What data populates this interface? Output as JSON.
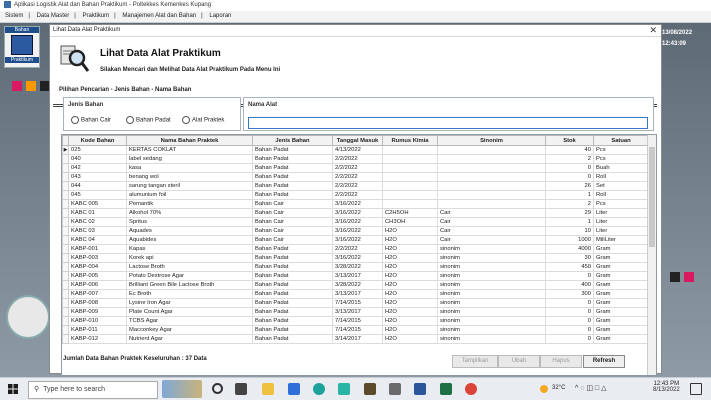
{
  "app": {
    "title": "Aplikasi Logistik Alat dan Bahan Praktikum - Poltekkes Kemenkes Kupang",
    "menu": [
      "Sistem",
      "Data Master",
      "Praktikum",
      "Manajemen Alat dan Bahan",
      "Laporan"
    ]
  },
  "launcher": {
    "header": "Bahan",
    "footer": "Praktikum"
  },
  "desk_date": "13/08/2022",
  "desk_time": "12:43:09",
  "window": {
    "title": "Lihat Data Alat Praktikum",
    "close_glyph": "✕",
    "page_title": "Lihat Data Alat Praktikum",
    "page_subtitle": "Silakan Mencari dan Melihat Data Alat Praktikum Pada Menu Ini"
  },
  "filter": {
    "section_label": "Pilihan Pencarian - Jenis Bahan - Nama Bahan",
    "jenis_label": "Jenis Bahan",
    "options": [
      "Bahan Cair",
      "Bahan Padat",
      "Alat Praktek"
    ],
    "nama_label": "Nama Alat",
    "nama_value": ""
  },
  "table": {
    "columns": [
      "Kode Bahan",
      "Nama Bahan Praktek",
      "Jenis Bahan",
      "Tanggal Masuk",
      "Rumus Kimia",
      "Sinonim",
      "Stok",
      "Satuan"
    ],
    "rows": [
      [
        "025",
        "KERTAS COKLAT",
        "Bahan Padat",
        "4/13/2022",
        "",
        "",
        "40",
        "Pcs"
      ],
      [
        "040",
        "label sedang",
        "Bahan Padat",
        "2/2/2022",
        "",
        "",
        "2",
        "Pcs"
      ],
      [
        "042",
        "kasa",
        "Bahan Padat",
        "2/2/2022",
        "",
        "",
        "0",
        "Buah"
      ],
      [
        "043",
        "benang wol",
        "Bahan Padat",
        "2/2/2022",
        "",
        "",
        "0",
        "Roll"
      ],
      [
        "044",
        "sarung tangan steril",
        "Bahan Padat",
        "2/2/2022",
        "",
        "",
        "26",
        "Set"
      ],
      [
        "045",
        "alumunium foil",
        "Bahan Padat",
        "2/2/2022",
        "",
        "",
        "1",
        "Roll"
      ],
      [
        "KABC 005",
        "Pemantik",
        "Bahan Cair",
        "3/16/2022",
        "",
        "",
        "2",
        "Pcs"
      ],
      [
        "KABC 01",
        "Alkohol 70%",
        "Bahan Cair",
        "3/16/2022",
        "C2H5OH",
        "Cair",
        "29",
        "Liter"
      ],
      [
        "KABC 02",
        "Spritus",
        "Bahan Cair",
        "3/16/2022",
        "CH3OH",
        "Cair",
        "1",
        "Liter"
      ],
      [
        "KABC 03",
        "Aquades",
        "Bahan Cair",
        "3/16/2022",
        "H2O",
        "Cair",
        "10",
        "Liter"
      ],
      [
        "KABC 04",
        "Aquabides",
        "Bahan Cair",
        "3/16/2022",
        "H2O",
        "Cair",
        "1000",
        "MiliLiter"
      ],
      [
        "KABP-001",
        "Kapas",
        "Bahan Padat",
        "2/2/2022",
        "H2O",
        "sinonim",
        "4000",
        "Gram"
      ],
      [
        "KABP-003",
        "Korek api",
        "Bahan Padat",
        "3/16/2022",
        "H2O",
        "sinonim",
        "30",
        "Gram"
      ],
      [
        "KABP-004",
        "Lactose Broth",
        "Bahan Padat",
        "3/28/2022",
        "H2O",
        "sinonim",
        "450",
        "Gram"
      ],
      [
        "KABP-005",
        "Potato Dextrose Agar",
        "Bahan Padat",
        "3/13/2017",
        "H2O",
        "sinonim",
        "0",
        "Gram"
      ],
      [
        "KABP-006",
        "Brilliant Green Bile Lactose Broth",
        "Bahan Padat",
        "3/28/2022",
        "H2O",
        "sinonim",
        "400",
        "Gram"
      ],
      [
        "KABP-007",
        "Ec Broth",
        "Bahan Padat",
        "3/13/2017",
        "H2O",
        "sinonim",
        "300",
        "Gram"
      ],
      [
        "KABP-008",
        "Lysine Iron Agar",
        "Bahan Padat",
        "7/14/2015",
        "H2O",
        "sinonim",
        "0",
        "Gram"
      ],
      [
        "KABP-009",
        "Plate Count Agar",
        "Bahan Padat",
        "3/13/2017",
        "H2O",
        "sinonim",
        "0",
        "Gram"
      ],
      [
        "KABP-010",
        "TCBS Agar",
        "Bahan Padat",
        "7/14/2015",
        "H2O",
        "sinonim",
        "0",
        "Gram"
      ],
      [
        "KABP-011",
        "Macconkey Agar",
        "Bahan Padat",
        "7/14/2015",
        "H2O",
        "sinonim",
        "0",
        "Gram"
      ],
      [
        "KABP-012",
        "Nutrient Agar",
        "Bahan Padat",
        "3/14/2017",
        "H2O",
        "sinonim",
        "0",
        "Gram"
      ]
    ],
    "selected_marker": "▶"
  },
  "footer": {
    "total": "Jumlah Data Bahan Praktek Keseluruhan : 37 Data",
    "buttons": [
      "Tampilkan",
      "Ubah",
      "Hapus",
      "Refresh"
    ]
  },
  "taskbar": {
    "search_placeholder": "Type here to search",
    "weather": "32°C",
    "time": "12:43 PM",
    "date": "8/13/2022"
  }
}
